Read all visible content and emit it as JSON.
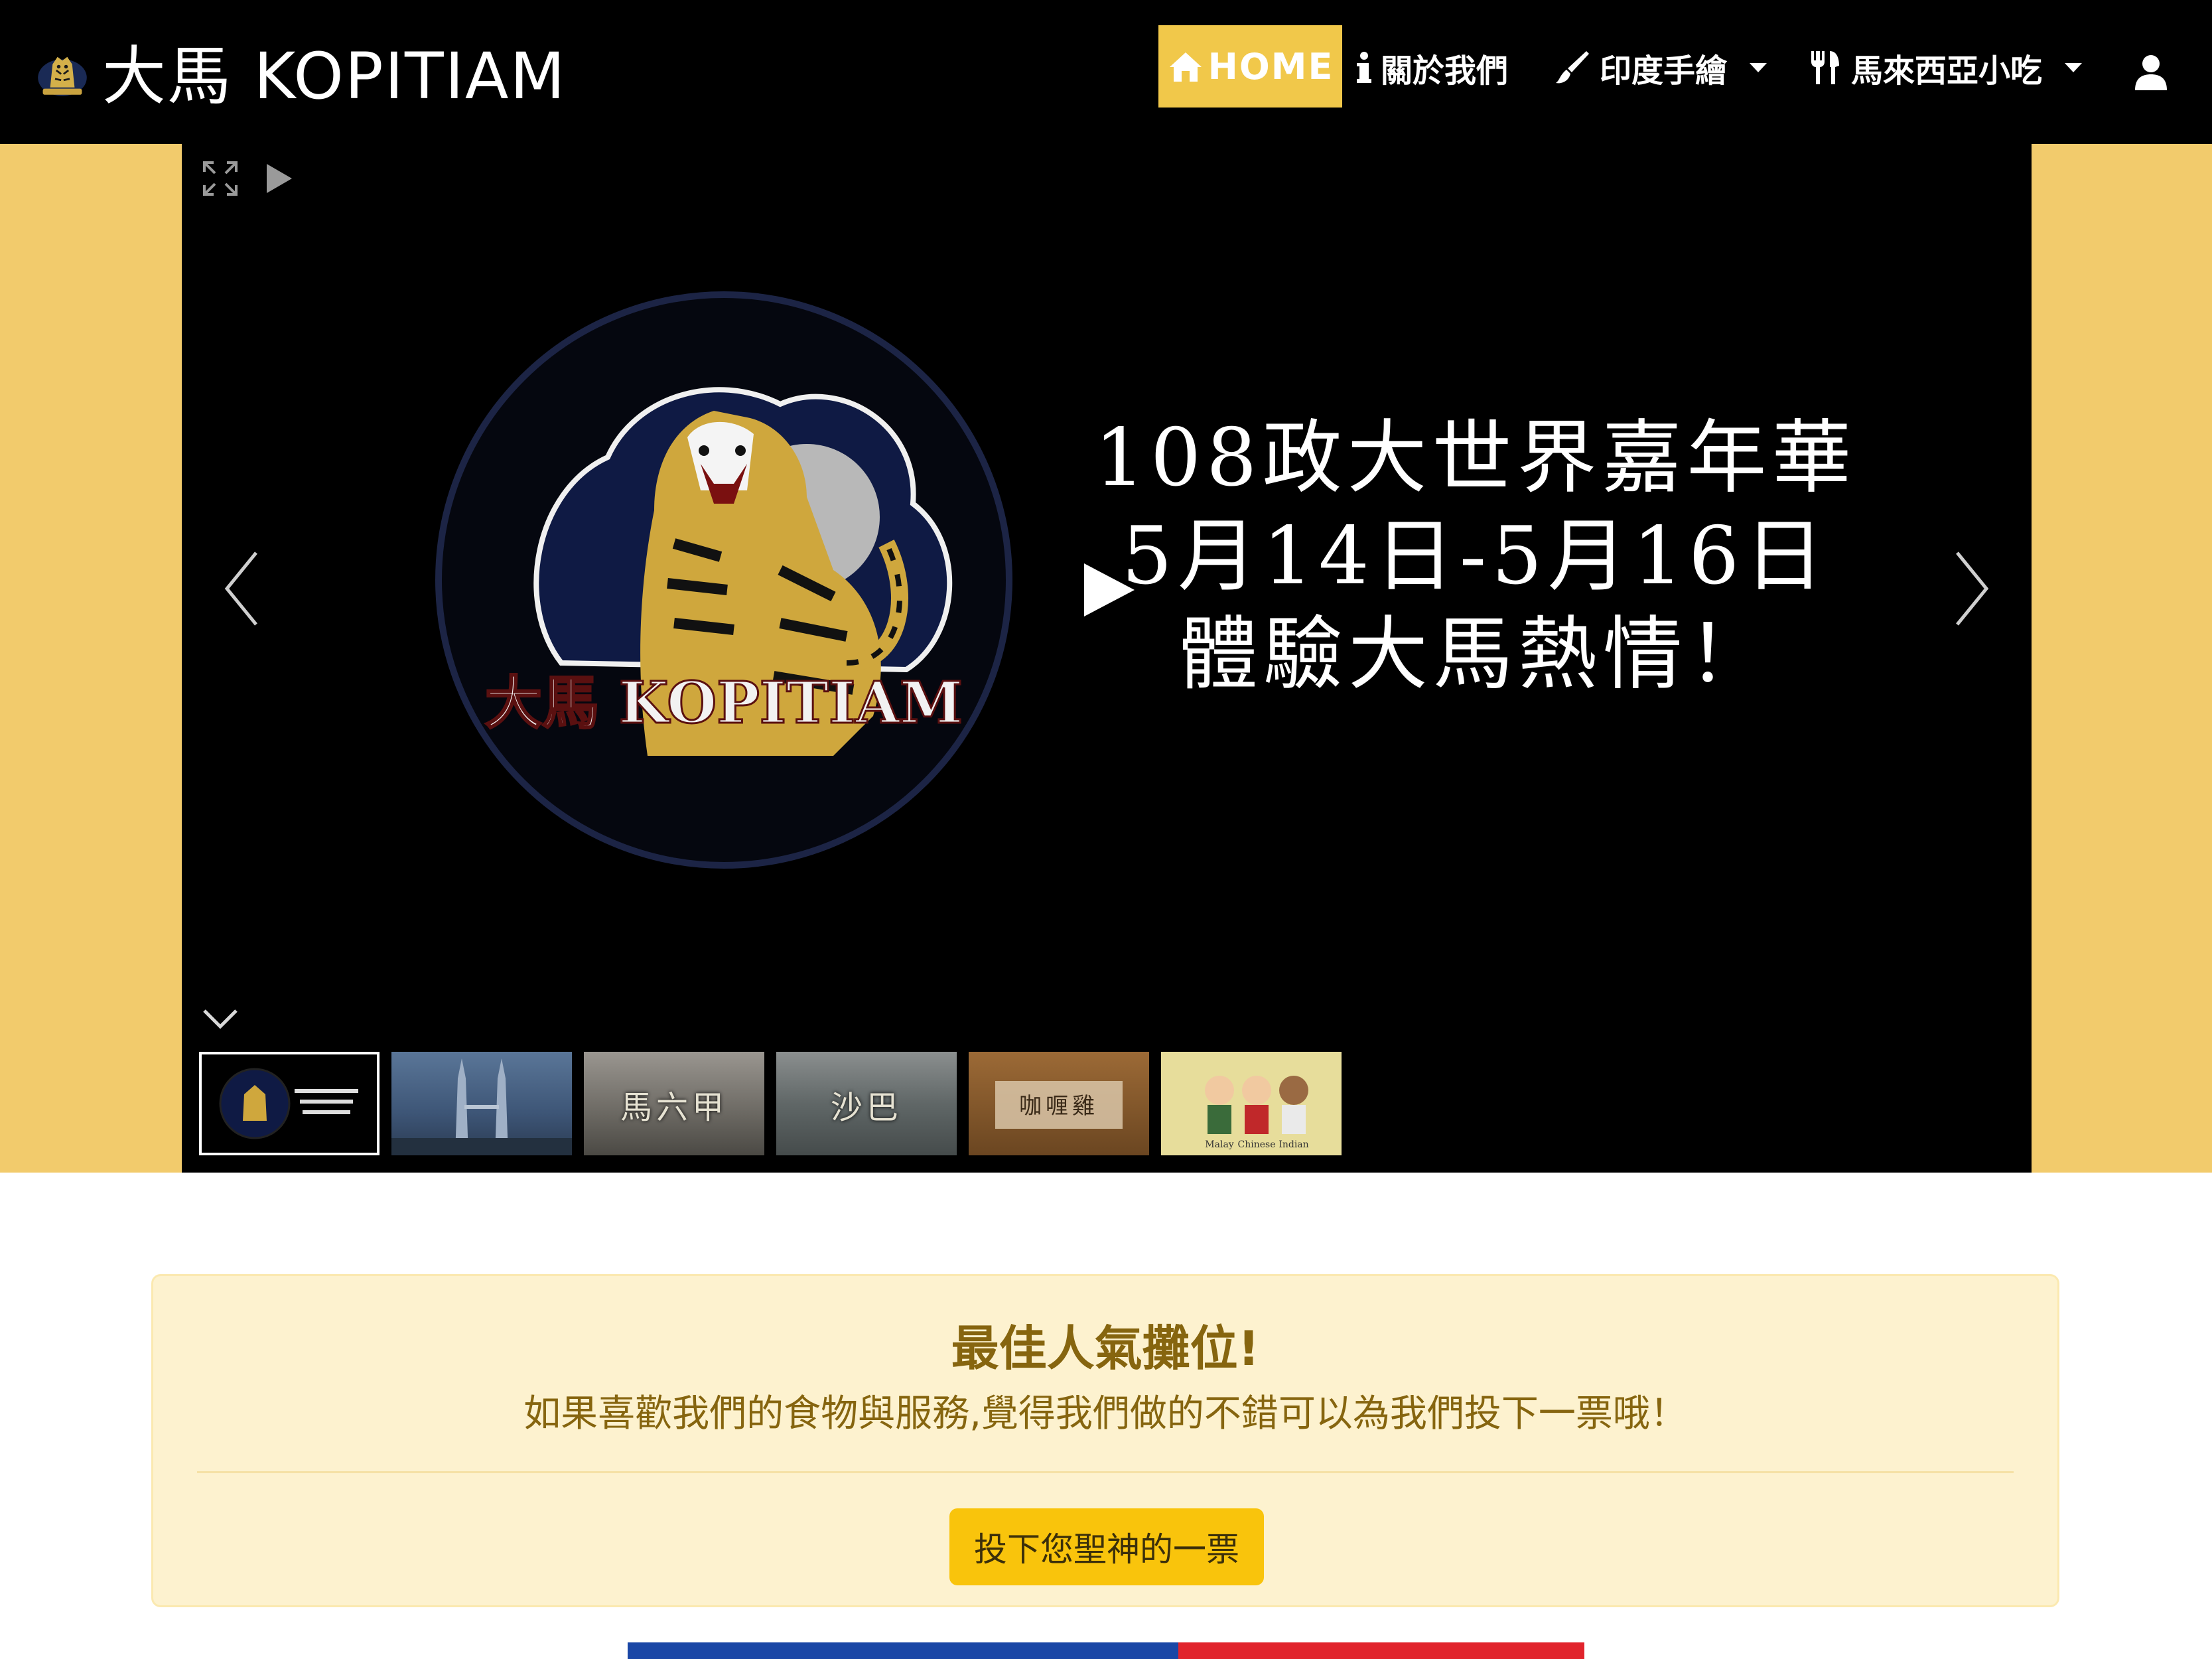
{
  "navbar": {
    "brand": {
      "text": "大馬 KOPITIAM",
      "logo_icon": "tiger-logo-icon"
    },
    "items": [
      {
        "label": "HOME",
        "icon": "home-icon",
        "active": true
      },
      {
        "label": "關於我們",
        "icon": "info-icon"
      },
      {
        "label": "印度手繪",
        "icon": "paintbrush-icon",
        "dropdown": true
      },
      {
        "label": "馬來西亞小吃",
        "icon": "utensils-icon",
        "dropdown": true
      }
    ],
    "user_icon": "user-icon"
  },
  "gallery": {
    "slide": {
      "emblem_text": "大馬 KOPITIAM",
      "lines": [
        "108政大世界嘉年華",
        "5月14日-5月16日",
        "體驗大馬熱情！"
      ]
    },
    "thumbnails": [
      {
        "caption": "",
        "kind": "logo-slide"
      },
      {
        "caption": "",
        "kind": "towers-photo"
      },
      {
        "caption": "馬六甲",
        "kind": "street-photo"
      },
      {
        "caption": "沙巴",
        "kind": "sea-photo"
      },
      {
        "caption": "咖喱雞",
        "kind": "food-photo"
      },
      {
        "caption": "",
        "kind": "people-illustration",
        "labels": [
          "Malay",
          "Chinese",
          "Indian"
        ]
      }
    ],
    "icons": [
      "fullscreen-icon",
      "autoplay-icon",
      "chevron-left-icon",
      "chevron-right-icon",
      "play-icon",
      "chevron-down-icon"
    ]
  },
  "vote": {
    "title": "最佳人氣攤位!",
    "description": "如果喜歡我們的食物與服務,覺得我們做的不錯可以為我們投下一票哦！",
    "button_label": "投下您聖神的一票"
  },
  "colors": {
    "accent": "#f1c84a",
    "band": "#f2cb6c",
    "card_bg": "#fdf2cf",
    "card_text": "#86650f",
    "button": "#f9c40c",
    "flag_blue": "#1a47a6",
    "flag_red": "#e1242c"
  }
}
